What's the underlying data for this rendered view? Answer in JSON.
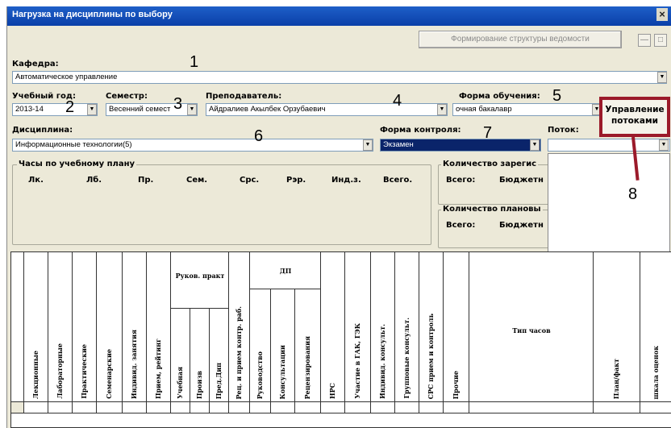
{
  "window": {
    "title": "Нагрузка на дисциплины по выбору",
    "close_label": "×"
  },
  "toolbar": {
    "struct_button": "Формирование структуры ведомости",
    "min_label": "—",
    "restore_label": "□"
  },
  "kafedra": {
    "label": "Кафедра:",
    "value": "Автоматическое управление"
  },
  "year": {
    "label": "Учебный год:",
    "value": "2013-14"
  },
  "semester": {
    "label": "Семестр:",
    "value": "Весенний семест"
  },
  "teacher": {
    "label": "Преподаватель:",
    "value": "Айдралиев Акылбек Орзубаевич"
  },
  "study_form": {
    "label": "Форма обучения:",
    "value": "очная бакалавр"
  },
  "discipline": {
    "label": "Дисциплина:",
    "value": "Информационные технологии(5)"
  },
  "control_form": {
    "label": "Форма контроля:",
    "value": "Экзамен"
  },
  "stream": {
    "label": "Поток:",
    "value": ""
  },
  "annotation": {
    "stream_management": "Управление потоками"
  },
  "numbers": [
    "1",
    "2",
    "3",
    "4",
    "5",
    "6",
    "7",
    "8"
  ],
  "hours": {
    "title": "Часы по учебному плану",
    "columns": [
      "Лк.",
      "Лб.",
      "Пр.",
      "Сем.",
      "Срс.",
      "Рэр.",
      "Инд.з.",
      "Всего."
    ]
  },
  "registered": {
    "title": "Количество зарегис",
    "total": "Всего:",
    "budget": "Бюджетн"
  },
  "planned": {
    "title": "Количество плановы",
    "total": "Всего:",
    "budget": "Бюджетн"
  },
  "table": {
    "vertical_headers": [
      "Лекционные",
      "Лабораторные",
      "Практические",
      "Семенарские",
      "Индивид. занятия",
      "Прием, рейтинг",
      "Учебная",
      "Произв",
      "Пред.Дип",
      "Рец. и прием контр. раб.",
      "Руководство",
      "Консультации",
      "Рецензирования",
      "НРС",
      "Участие в ГАК, ГЭК",
      "Индивид. консульт.",
      "Групповые консульт.",
      "СРС прием и контроль",
      "Прочие"
    ],
    "group_practice": "Руков. практ",
    "group_dp": "ДП",
    "hours_type": "Тип часов",
    "plan_fact": "План/факт",
    "grading_scale": "шкала оценок"
  }
}
